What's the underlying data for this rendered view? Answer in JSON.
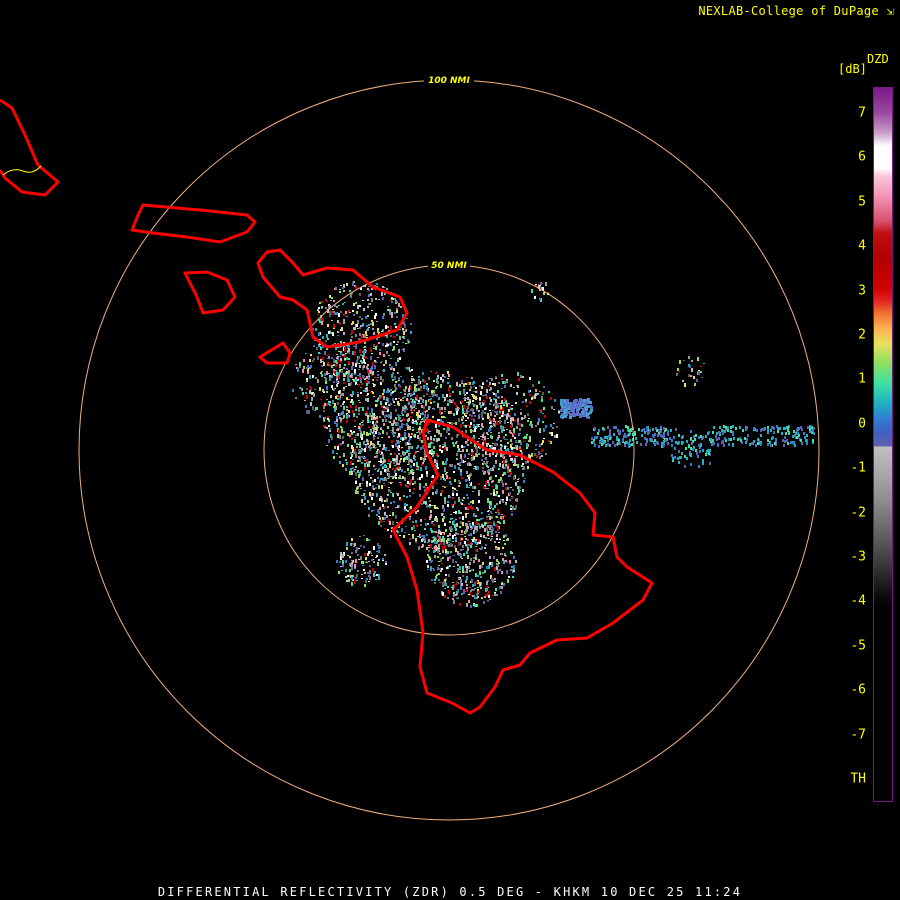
{
  "header": {
    "credit": "NEXLAB-College of DuPage",
    "credit_icon": "corner-arrow-icon"
  },
  "legend": {
    "product": "DZD",
    "units": "[dB]",
    "ticks": [
      "7",
      "6",
      "5",
      "4",
      "3",
      "2",
      "1",
      "0",
      "-1",
      "-2",
      "-3",
      "-4",
      "-5",
      "-6",
      "-7",
      "TH"
    ]
  },
  "rings": {
    "outer_label": "100 NMI",
    "inner_label": "50 NMI",
    "color": "#f0b080"
  },
  "coast_color": "#ff0000",
  "footer": {
    "caption": "DIFFERENTIAL REFLECTIVITY (ZDR) 0.5 DEG - KHKM 10 DEC 25 11:24"
  }
}
